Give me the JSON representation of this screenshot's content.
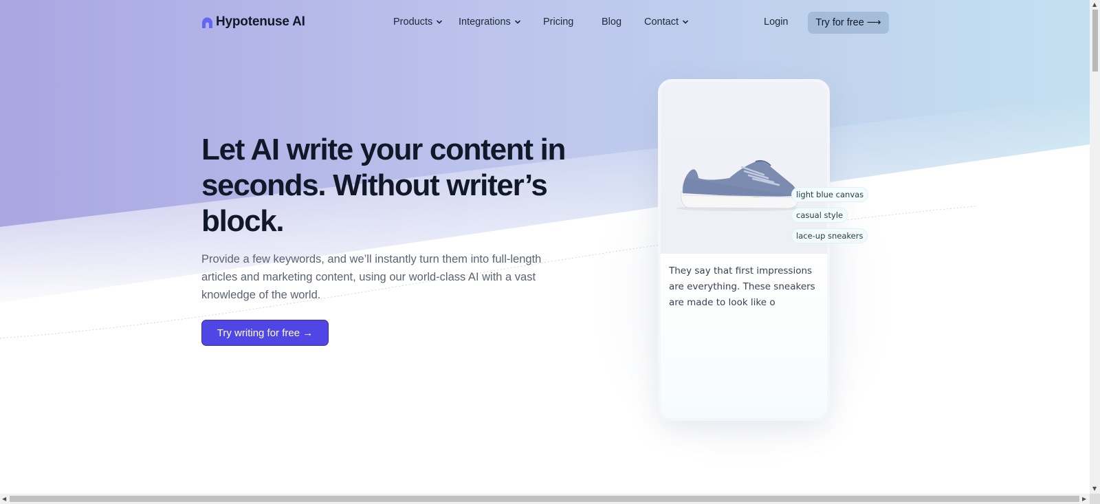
{
  "header": {
    "brand": "Hypotenuse AI",
    "nav": {
      "products": "Products",
      "integrations": "Integrations",
      "pricing": "Pricing",
      "blog": "Blog",
      "contact": "Contact"
    },
    "login": "Login",
    "try_free": "Try for free ⟶"
  },
  "hero": {
    "headline": "Let AI write your content in seconds. Without writer’s block.",
    "subtext": "Provide a few keywords, and we’ll instantly turn them into full-length articles and marketing content, using our world-class AI with a vast knowledge of the world.",
    "cta": "Try writing for free →"
  },
  "demo_card": {
    "tags": [
      "light blue canvas",
      "casual style",
      "lace-up sneakers"
    ],
    "generated_text": "They say that first impressions are everything. These sneakers are made to look like o"
  },
  "colors": {
    "accent": "#4f46e5",
    "gradient_start": "#a9a6e2",
    "gradient_end": "#c6e2f0"
  }
}
